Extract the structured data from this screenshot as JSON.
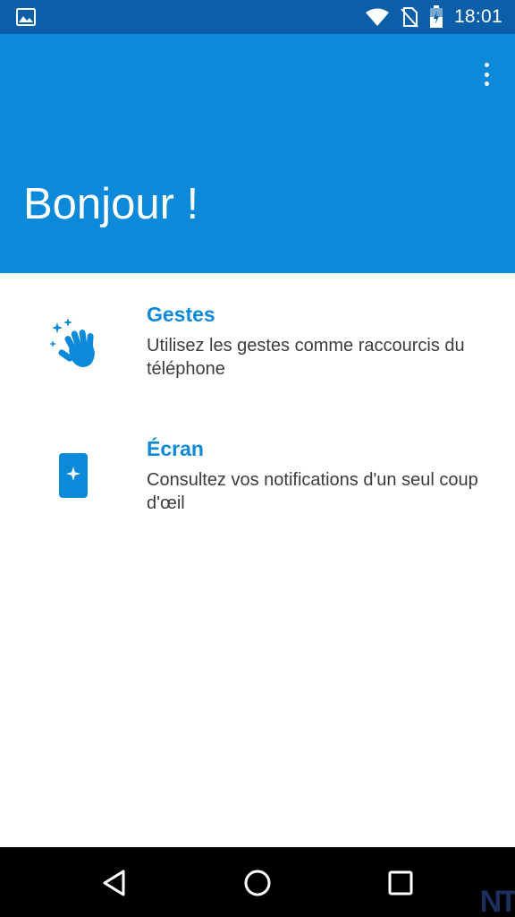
{
  "status_bar": {
    "time": "18:01",
    "icons": [
      "gallery-icon",
      "wifi-icon",
      "no-sim-icon",
      "battery-icon"
    ]
  },
  "app_bar": {
    "title": "Bonjour !",
    "menu_icon": "more-vert-icon"
  },
  "features": [
    {
      "title": "Gestes",
      "description": "Utilisez les gestes comme raccourcis du téléphone",
      "icon": "waving-hand-icon"
    },
    {
      "title": "Écran",
      "description": "Consultez vos notifications d'un seul coup d'œil",
      "icon": "phone-sparkle-icon"
    }
  ],
  "nav_bar": {
    "icons": [
      "back-icon",
      "home-icon",
      "recents-icon"
    ]
  },
  "colors": {
    "status_bar": "#0a5fa8",
    "app_bar": "#0c89d9",
    "accent": "#0c89d9",
    "body_text": "#3c3c3c"
  },
  "watermark": "NT"
}
